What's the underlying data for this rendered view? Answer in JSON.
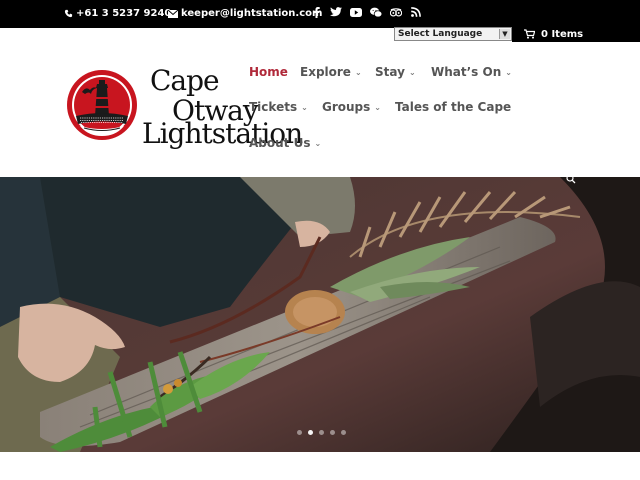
{
  "topbar": {
    "phone": "+61 3 5237 9240",
    "email": "keeper@lightstation.com",
    "social_icons": [
      "facebook-icon",
      "twitter-icon",
      "youtube-icon",
      "wechat-icon",
      "tripadvisor-icon",
      "rss-icon"
    ]
  },
  "language": {
    "selected": "Select Language"
  },
  "cart": {
    "label": "0 Items"
  },
  "logo": {
    "line1": "Cape",
    "line2": "Otway",
    "line3": "Lightstation"
  },
  "nav": {
    "home": "Home",
    "explore": "Explore",
    "stay": "Stay",
    "whats_on": "What’s On",
    "tickets": "Tickets",
    "groups": "Groups",
    "tales": "Tales of the Cape",
    "about": "About Us"
  },
  "colors": {
    "accent": "#b0293a",
    "topbar": "#000000",
    "nav_text": "#555555"
  },
  "slider": {
    "slide_count": 5,
    "active_slide": 2
  }
}
